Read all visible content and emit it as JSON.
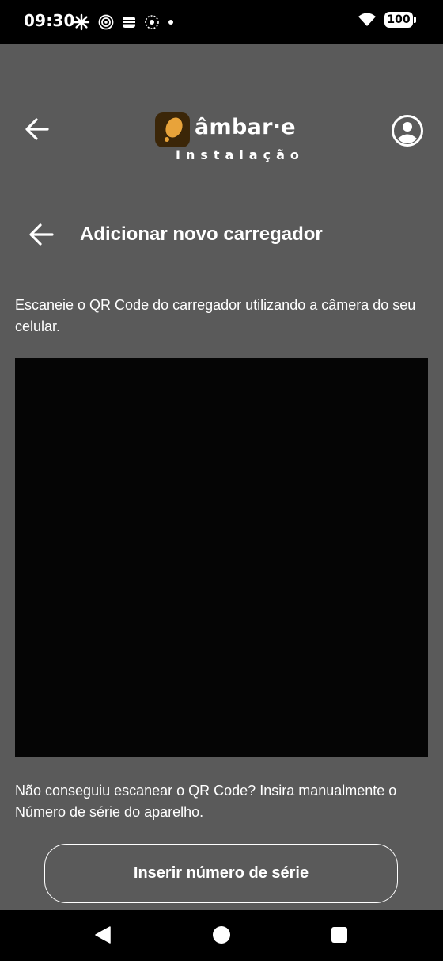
{
  "status_bar": {
    "time": "09:30",
    "battery": "100",
    "icons": [
      "pinwheel-icon",
      "target-icon",
      "wallet-icon",
      "data-saver-icon",
      "notification-dot-icon",
      "wifi-icon",
      "battery-icon"
    ]
  },
  "header": {
    "logo_word": "âmbar·e",
    "logo_subtitle": "Instalação",
    "back_icon": "arrow-left-icon",
    "account_icon": "account-circle-icon"
  },
  "page": {
    "title": "Adicionar novo carregador",
    "back_icon": "arrow-left-icon",
    "instructions": "Escaneie o QR Code do carregador utilizando a câmera do seu celular.",
    "help_text": "Não conseguiu escanear o QR Code? Insira manualmente o Número de série do aparelho.",
    "serial_button_label": "Inserir número de série"
  },
  "colors": {
    "background": "#5a5a5a",
    "camera_view": "#050505",
    "brand_accent": "#e8a33a",
    "text": "#ffffff"
  },
  "nav_bar": {
    "icons": [
      "back-triangle-icon",
      "home-circle-icon",
      "recents-square-icon"
    ]
  }
}
